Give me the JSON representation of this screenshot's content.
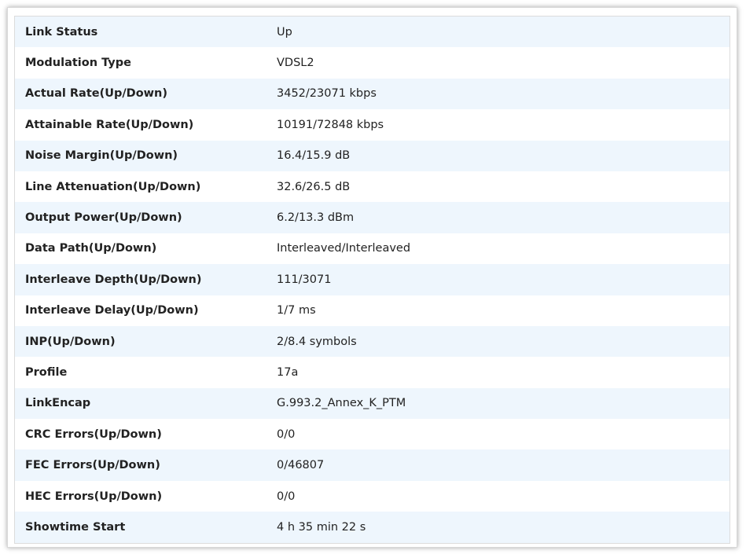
{
  "rows": [
    {
      "label": "Link Status",
      "value": "Up"
    },
    {
      "label": "Modulation Type",
      "value": "VDSL2"
    },
    {
      "label": "Actual Rate(Up/Down)",
      "value": "3452/23071 kbps"
    },
    {
      "label": "Attainable Rate(Up/Down)",
      "value": "10191/72848 kbps"
    },
    {
      "label": "Noise Margin(Up/Down)",
      "value": "16.4/15.9 dB"
    },
    {
      "label": "Line Attenuation(Up/Down)",
      "value": "32.6/26.5 dB"
    },
    {
      "label": "Output Power(Up/Down)",
      "value": "6.2/13.3 dBm"
    },
    {
      "label": "Data Path(Up/Down)",
      "value": "Interleaved/Interleaved"
    },
    {
      "label": "Interleave Depth(Up/Down)",
      "value": "111/3071"
    },
    {
      "label": "Interleave Delay(Up/Down)",
      "value": "1/7 ms"
    },
    {
      "label": "INP(Up/Down)",
      "value": "2/8.4 symbols"
    },
    {
      "label": "Profile",
      "value": "17a"
    },
    {
      "label": "LinkEncap",
      "value": "G.993.2_Annex_K_PTM"
    },
    {
      "label": "CRC Errors(Up/Down)",
      "value": "0/0"
    },
    {
      "label": "FEC Errors(Up/Down)",
      "value": "0/46807"
    },
    {
      "label": "HEC Errors(Up/Down)",
      "value": "0/0"
    },
    {
      "label": "Showtime Start",
      "value": "4 h 35 min 22 s"
    }
  ]
}
